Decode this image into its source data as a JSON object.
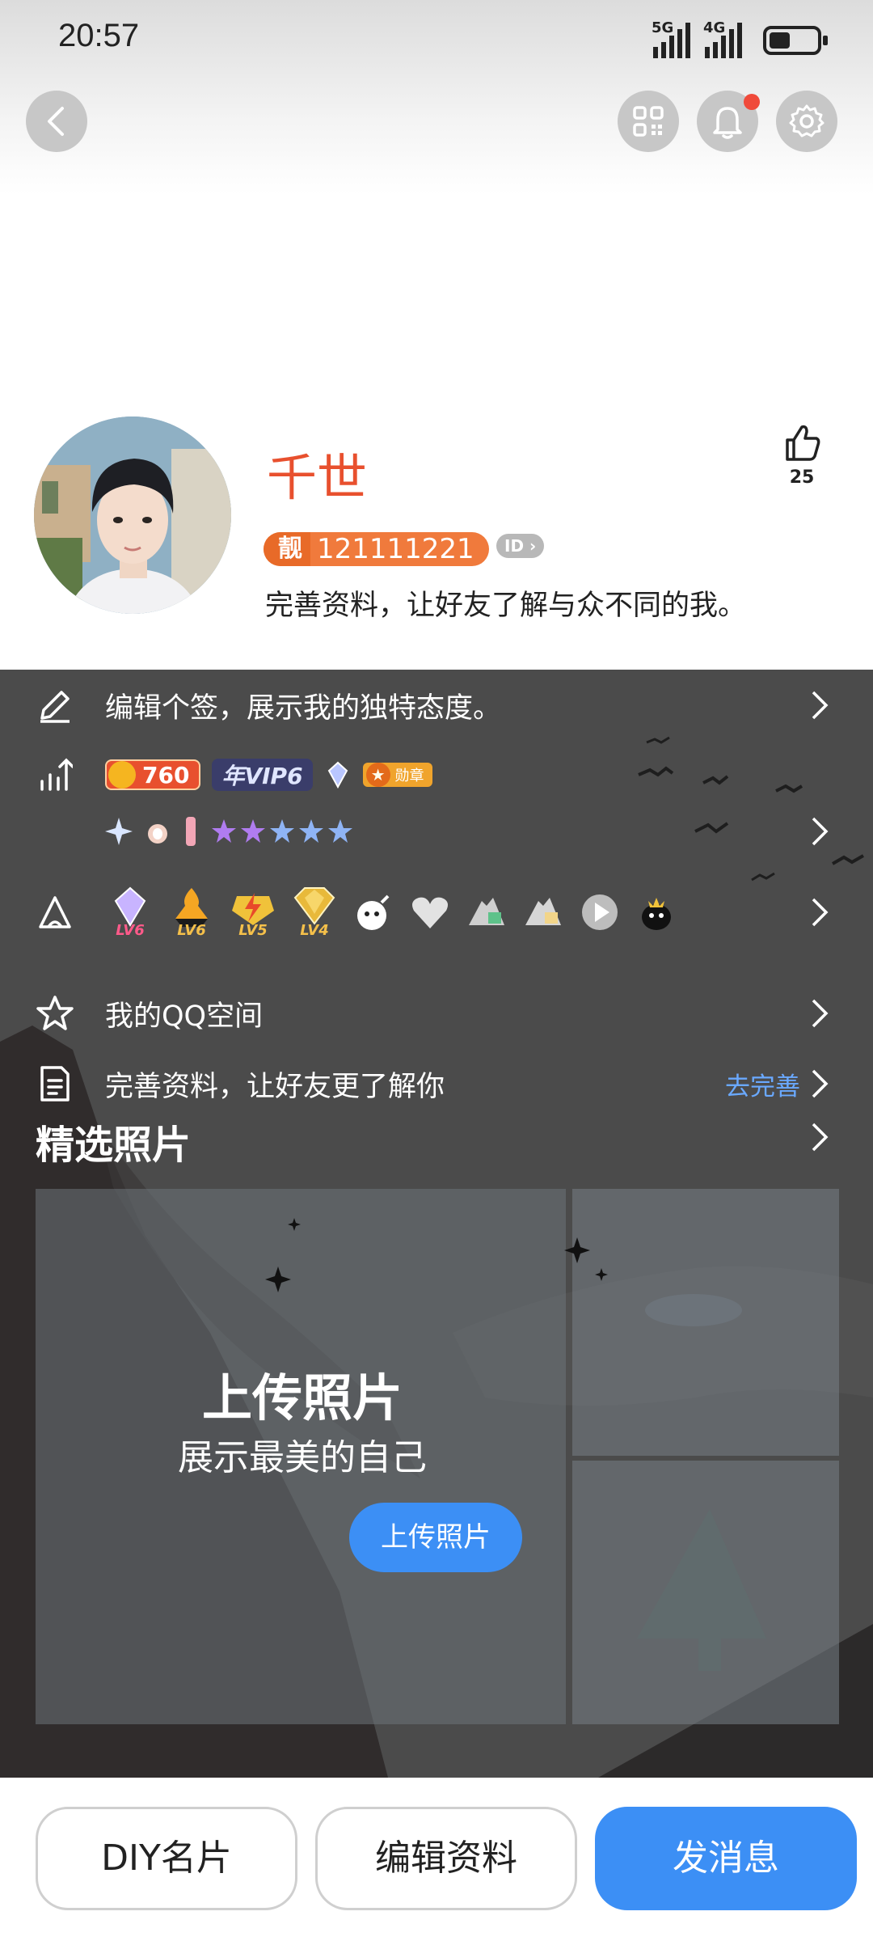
{
  "status": {
    "time": "20:57",
    "network1": "5G",
    "network2": "4G",
    "battery_level": 0.45
  },
  "profile": {
    "name": "千世",
    "liang_label": "靓",
    "qq_number": "121111221",
    "id_tag": "ID",
    "tip": "完善资料，让好友了解与众不同的我。",
    "likes": "25"
  },
  "rows": {
    "signature": "编辑个签，展示我的独特态度。",
    "coin_value": "760",
    "vip_label": "年VIP6",
    "medal_label": "勋章",
    "game_levels": [
      "LV6",
      "LV6",
      "LV5",
      "LV4"
    ],
    "qzone": "我的QQ空间",
    "complete_profile": "完善资料，让好友更了解你",
    "go_complete": "去完善"
  },
  "photos": {
    "section_title": "精选照片",
    "upload_title": "上传照片",
    "upload_sub": "展示最美的自己",
    "upload_button": "上传照片"
  },
  "bottom": {
    "diy": "DIY名片",
    "edit": "编辑资料",
    "message": "发消息"
  },
  "colors": {
    "accent": "#3c8ff5",
    "name": "#e8502e",
    "dark_bg": "#4b4b4b"
  }
}
